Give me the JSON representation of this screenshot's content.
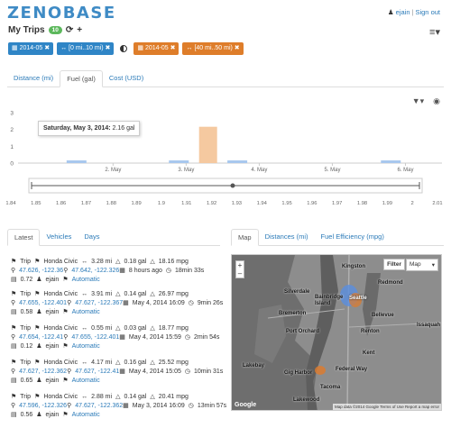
{
  "app": {
    "logo": "ZENOBASE"
  },
  "header": {
    "user": "ejain",
    "signout": "Sign out"
  },
  "page": {
    "title": "My Trips",
    "count": "10"
  },
  "filters": [
    {
      "label": "2014-05",
      "color": "#2f85c6"
    },
    {
      "label": "[0 mi..10 mi)",
      "color": "#2f85c6"
    },
    {
      "label": "2014-05",
      "color": "#de7d2a"
    },
    {
      "label": "[40 mi..50 mi)",
      "color": "#de7d2a"
    }
  ],
  "chart_tabs": [
    "Distance (mi)",
    "Fuel (gal)",
    "Cost (USD)"
  ],
  "chart_tooltip": {
    "date": "Saturday, May 3, 2014:",
    "value": "2.16 gal"
  },
  "chart_data": {
    "type": "bar",
    "ylim": [
      0,
      3
    ],
    "yticks": [
      "3",
      "2",
      "1",
      "0"
    ],
    "xticks": [
      "2. May",
      "3. May",
      "4. May",
      "5. May",
      "6. May"
    ],
    "series": [
      {
        "color": "#a8c8ee",
        "x": [
          1.5,
          2.9,
          3.7,
          5.8
        ],
        "values": [
          0.05,
          0.06,
          0.09,
          0.04
        ]
      },
      {
        "color": "#f5c9a0",
        "x": [
          3.3
        ],
        "values": [
          2.16
        ]
      }
    ],
    "navigator_ticks": [
      "1.84",
      "1.85",
      "1.86",
      "1.87",
      "1.88",
      "1.89",
      "1.9",
      "1.91",
      "1.92",
      "1.93",
      "1.94",
      "1.95",
      "1.96",
      "1.97",
      "1.98",
      "1.99",
      "2",
      "2.01"
    ]
  },
  "list_tabs": [
    "Latest",
    "Vehicles",
    "Days"
  ],
  "map_tabs": [
    "Map",
    "Distances (mi)",
    "Fuel Efficiency (mpg)"
  ],
  "trips": [
    {
      "type": "Trip",
      "car": "Honda Civic",
      "dist": "3.28 mi",
      "fuel": "0.18 gal",
      "mpg": "18.16 mpg",
      "from": "47.626, -122.36",
      "to": "47.642, -122.326",
      "when": "8 hours ago",
      "dur": "18min 33s",
      "cost": "0.72",
      "user": "ejain",
      "mode": "Automatic"
    },
    {
      "type": "Trip",
      "car": "Honda Civic",
      "dist": "3.91 mi",
      "fuel": "0.14 gal",
      "mpg": "26.97 mpg",
      "from": "47.655, -122.401",
      "to": "47.627, -122.367",
      "when": "May 4, 2014 16:09",
      "dur": "9min 26s",
      "cost": "0.58",
      "user": "ejain",
      "mode": "Automatic"
    },
    {
      "type": "Trip",
      "car": "Honda Civic",
      "dist": "0.55 mi",
      "fuel": "0.03 gal",
      "mpg": "18.77 mpg",
      "from": "47.654, -122.41",
      "to": "47.655, -122.401",
      "when": "May 4, 2014 15:59",
      "dur": "2min 54s",
      "cost": "0.12",
      "user": "ejain",
      "mode": "Automatic"
    },
    {
      "type": "Trip",
      "car": "Honda Civic",
      "dist": "4.17 mi",
      "fuel": "0.16 gal",
      "mpg": "25.52 mpg",
      "from": "47.627, -122.362",
      "to": "47.627, -122.41",
      "when": "May 4, 2014 15:05",
      "dur": "10min 31s",
      "cost": "0.65",
      "user": "ejain",
      "mode": "Automatic"
    },
    {
      "type": "Trip",
      "car": "Honda Civic",
      "dist": "2.88 mi",
      "fuel": "0.14 gal",
      "mpg": "20.41 mpg",
      "from": "47.596, -122.326",
      "to": "47.627, -122.362",
      "when": "May 3, 2014 16:09",
      "dur": "13min 57s",
      "cost": "0.56",
      "user": "ejain",
      "mode": "Automatic"
    }
  ],
  "map": {
    "filter": "Filter",
    "type": "Map",
    "labels": [
      "Kingston",
      "Silverdale",
      "Bainbridge Island",
      "Bremerton",
      "Port Orchard",
      "Seattle",
      "Redmond",
      "Bellevue",
      "Issaquah",
      "Renton",
      "Kent",
      "Federal Way",
      "Tacoma",
      "Lakebay",
      "Gig Harbor",
      "Lakewood"
    ],
    "attribution": "Map data ©2014 Google   Terms of Use   Report a map error",
    "google": "Google"
  }
}
